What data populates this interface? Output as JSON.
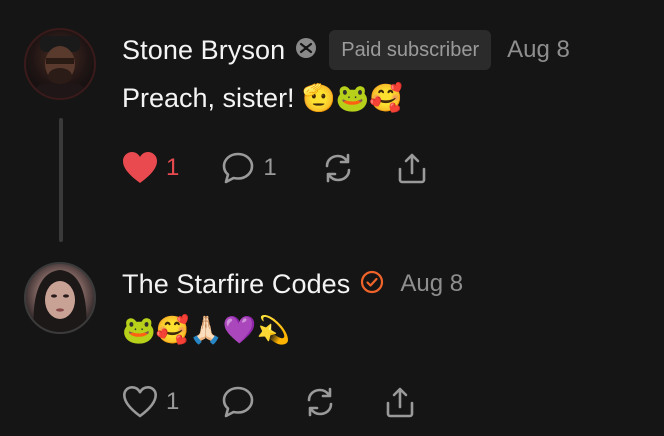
{
  "comments": [
    {
      "author": "Stone Bryson",
      "badge": "Paid subscriber",
      "date": "Aug 8",
      "text": "Preach, sister! 🫡🐸🥰",
      "likes": "1",
      "replies": "1",
      "liked": true
    },
    {
      "author": "The Starfire Codes",
      "date": "Aug 8",
      "text": "🐸🥰🙏🏻💜💫",
      "likes": "1",
      "liked": false
    }
  ],
  "colors": {
    "like_active": "#e84a4f",
    "verified": "#f0642a",
    "muted": "#9a9a9a"
  }
}
